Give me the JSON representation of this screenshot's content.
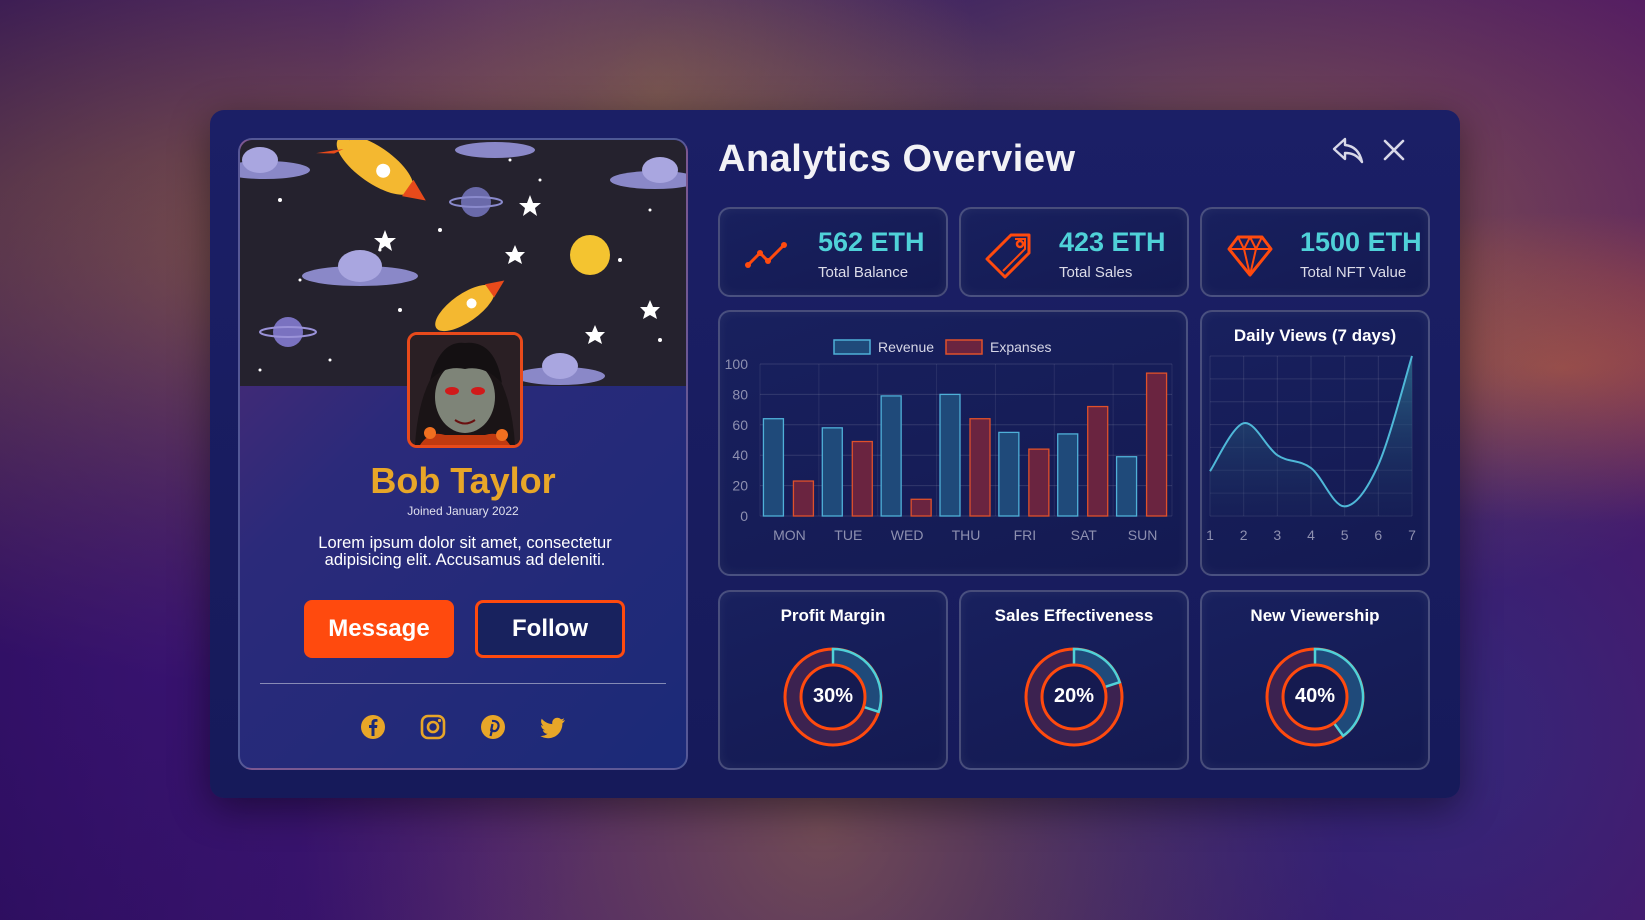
{
  "profile": {
    "name": "Bob Taylor",
    "joined": "Joined January 2022",
    "bio": "Lorem ipsum dolor sit amet, consectetur adipisicing elit. Accusamus ad deleniti.",
    "message_label": "Message",
    "follow_label": "Follow",
    "socials": [
      "facebook-icon",
      "instagram-icon",
      "pinterest-icon",
      "twitter-icon"
    ]
  },
  "header": {
    "title": "Analytics Overview",
    "icons": [
      "reply-icon",
      "close-icon"
    ]
  },
  "stats": [
    {
      "value": "562 ETH",
      "label": "Total Balance",
      "icon": "trend-icon"
    },
    {
      "value": "423 ETH",
      "label": "Total Sales",
      "icon": "tag-icon"
    },
    {
      "value": "1500 ETH",
      "label": "Total NFT Value",
      "icon": "diamond-icon"
    }
  ],
  "colors": {
    "accent_orange": "#ff4a0e",
    "teal": "#4fd1d8",
    "gold": "#e8a628",
    "revenue": "#1f4a7a",
    "expanses": "#6a2440"
  },
  "chart_data": [
    {
      "type": "bar",
      "categories": [
        "MON",
        "TUE",
        "WED",
        "THU",
        "FRI",
        "SAT",
        "SUN"
      ],
      "series": [
        {
          "name": "Revenue",
          "values": [
            64,
            58,
            79,
            80,
            55,
            54,
            39
          ]
        },
        {
          "name": "Expanses",
          "values": [
            23,
            49,
            11,
            64,
            44,
            72,
            94
          ]
        }
      ],
      "ylim": [
        0,
        100
      ],
      "yticks": [
        0,
        20,
        40,
        60,
        80,
        100
      ],
      "legend": "top-center",
      "grid": true
    },
    {
      "type": "area",
      "title": "Daily Views (7 days)",
      "x": [
        1,
        2,
        3,
        4,
        5,
        6,
        7
      ],
      "values": [
        28,
        58,
        38,
        30,
        6,
        32,
        100
      ],
      "ylim": [
        0,
        100
      ],
      "grid": true
    }
  ],
  "donuts": [
    {
      "title": "Profit Margin",
      "percent": 30,
      "label": "30%"
    },
    {
      "title": "Sales Effectiveness",
      "percent": 20,
      "label": "20%"
    },
    {
      "title": "New Viewership",
      "percent": 40,
      "label": "40%"
    }
  ]
}
